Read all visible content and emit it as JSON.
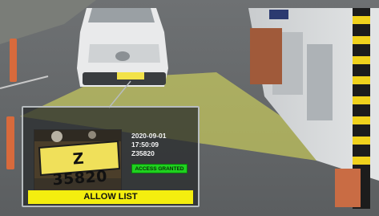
{
  "front_plate": {
    "text": ""
  },
  "overlay": {
    "plate_number": "Z 35820",
    "date": "2020-09-01",
    "time": "17:50:09",
    "plate_id": "Z35820",
    "access_status": "ACCESS GRANTED",
    "list_name": "ALLOW LIST"
  },
  "colors": {
    "access_badge": "#1fd11f",
    "allow_bar": "#f4ee0f",
    "detection_zone": "#e4e65a"
  },
  "icons": [
    "detection-cone",
    "bollard",
    "barrier-gate"
  ]
}
